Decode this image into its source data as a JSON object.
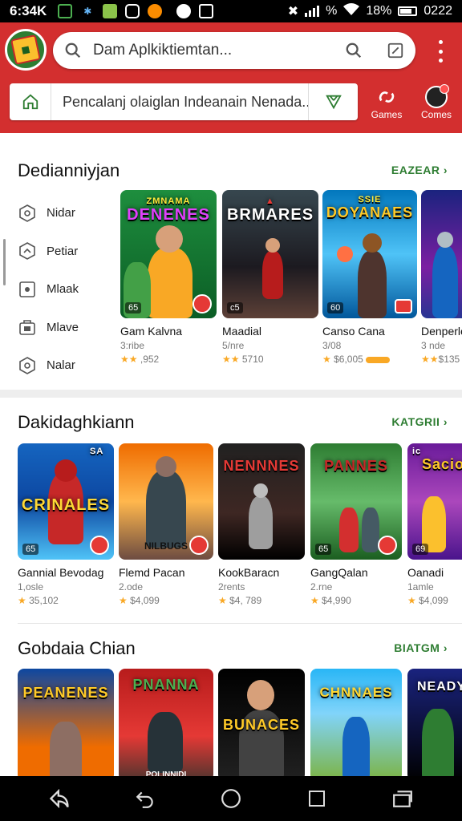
{
  "status_bar": {
    "time": "6:34K",
    "battery": "18%",
    "clock2": "0222",
    "signal_label": "%"
  },
  "header": {
    "search_placeholder": "Dam Aplkiktiemtan...",
    "subsearch_text": "Pencalanj olaiglan Indeanain Nenada...",
    "tabs": [
      {
        "label": "Games",
        "icon": "chat-link-icon"
      },
      {
        "label": "Comes",
        "icon": "avatar-icon"
      }
    ]
  },
  "sections": [
    {
      "title": "Dedianniyjan",
      "more": "EAZEAR",
      "side_items": [
        {
          "label": "Nidar",
          "icon": "hexagon-circle-icon"
        },
        {
          "label": "Petiar",
          "icon": "hexagon-arrow-icon"
        },
        {
          "label": "Mlaak",
          "icon": "square-dot-icon"
        },
        {
          "label": "Mlave",
          "icon": "bag-icon"
        },
        {
          "label": "Nalar",
          "icon": "hexagon-circle-icon"
        }
      ],
      "cards": [
        {
          "art_title": "DENENES",
          "art_top": "ZMNAMA",
          "badge": "65",
          "name": "Gam Kalvna",
          "sub": "3:ribe",
          "rating": ",952"
        },
        {
          "art_title": "BRMARES",
          "art_top": "",
          "badge": "c5",
          "name": "Maadial",
          "sub": "5/nre",
          "rating": "5710"
        },
        {
          "art_title": "DOYANAES",
          "art_top": "SSIE",
          "badge": "60",
          "name": "Canso Cana",
          "sub": "3/08",
          "rating": "$6,005"
        },
        {
          "art_title": "",
          "art_top": "",
          "badge": "",
          "name": "Denperle",
          "sub": "3 nde",
          "rating": "$135"
        }
      ]
    },
    {
      "title": "Dakidaghkiann",
      "more": "KATGRII",
      "cards": [
        {
          "art_title": "CRINALES",
          "art_top": "SA",
          "badge": "65",
          "name": "Gannial Bevodag",
          "sub": "1,osle",
          "rating": "35,102"
        },
        {
          "art_title": "",
          "art_sub": "NILBUGS",
          "badge": "",
          "name": "Flemd Pacan",
          "sub": "2.ode",
          "rating": "$4,099"
        },
        {
          "art_title": "NENNNES",
          "art_top": "",
          "badge": "",
          "name": "KookBaracn",
          "sub": "2rents",
          "rating": "$4, 789"
        },
        {
          "art_title": "PANNES",
          "art_top": "",
          "badge": "65",
          "name": "GangQalan",
          "sub": "2.rne",
          "rating": "$4,990"
        },
        {
          "art_title": "Sacio",
          "art_top": "ic",
          "badge": "69",
          "name": "Oanadi",
          "sub": "1amle",
          "rating": "$4,099"
        }
      ]
    },
    {
      "title": "Gobdaia Chian",
      "more": "BIATGM",
      "cards": [
        {
          "art_title": "PEANENES"
        },
        {
          "art_title": "PNANNA",
          "art_sub": "POLINNIDI"
        },
        {
          "art_title": "BUNACES"
        },
        {
          "art_title": "CHNNAES"
        },
        {
          "art_title": "NEADY"
        }
      ]
    }
  ],
  "nav": [
    "back-icon",
    "undo-icon",
    "home-icon",
    "recents-icon",
    "switch-icon"
  ],
  "colors": {
    "header": "#d32f2f",
    "accent": "#2e7d32",
    "star": "#f9a825"
  }
}
